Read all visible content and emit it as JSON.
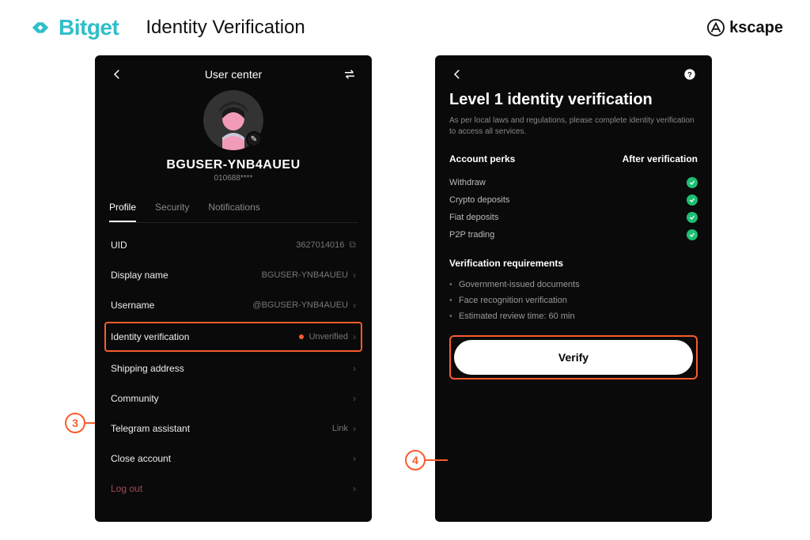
{
  "header": {
    "brand": "Bitget",
    "page_title": "Identity Verification",
    "right_brand": "kscape"
  },
  "callouts": {
    "step3": "3",
    "step4": "4"
  },
  "phone_left": {
    "header_title": "User center",
    "username": "BGUSER-YNB4AUEU",
    "userid": "010688****",
    "tabs": {
      "profile": "Profile",
      "security": "Security",
      "notifications": "Notifications"
    },
    "rows": {
      "uid": {
        "label": "UID",
        "value": "3627014016"
      },
      "display_name": {
        "label": "Display name",
        "value": "BGUSER-YNB4AUEU"
      },
      "username": {
        "label": "Username",
        "value": "@BGUSER-YNB4AUEU"
      },
      "identity": {
        "label": "Identity verification",
        "value": "Unverified"
      },
      "shipping": {
        "label": "Shipping address"
      },
      "community": {
        "label": "Community"
      },
      "telegram": {
        "label": "Telegram assistant",
        "value": "Link"
      },
      "close_account": {
        "label": "Close account"
      },
      "logout": {
        "label": "Log out"
      }
    }
  },
  "phone_right": {
    "title": "Level 1 identity verification",
    "subtitle": "As per local laws and regulations, please complete identity verification to access all services.",
    "perks_head_left": "Account perks",
    "perks_head_right": "After verification",
    "perks": {
      "withdraw": "Withdraw",
      "crypto_deposits": "Crypto deposits",
      "fiat_deposits": "Fiat deposits",
      "p2p": "P2P trading"
    },
    "reqs_title": "Verification requirements",
    "reqs": {
      "r1": "Government-issued documents",
      "r2": "Face recognition verification",
      "r3": "Estimated review time: 60 min"
    },
    "verify_label": "Verify"
  }
}
